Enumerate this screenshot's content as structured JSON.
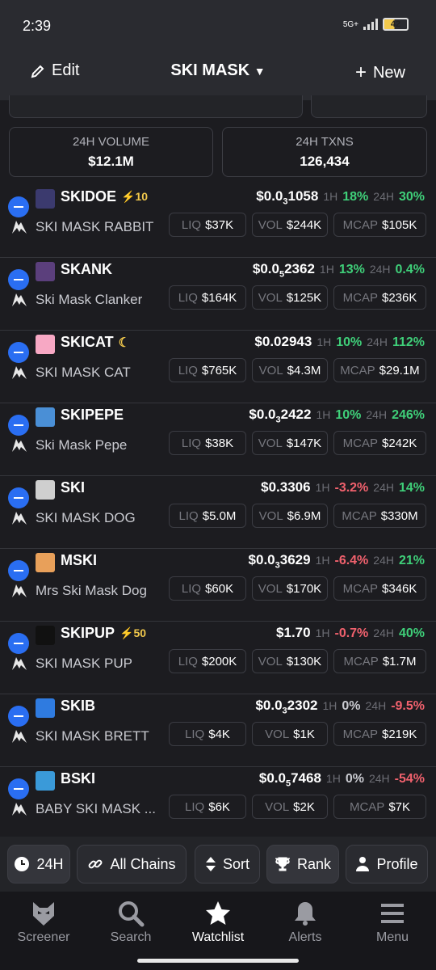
{
  "status": {
    "time": "2:39",
    "net": "5G+",
    "battery": "42"
  },
  "header": {
    "edit": "Edit",
    "title": "SKI MASK",
    "new": "New"
  },
  "stats": [
    {
      "label": "24H VOLUME",
      "value": "$12.1M"
    },
    {
      "label": "24H TXNS",
      "value": "126,434"
    }
  ],
  "labels": {
    "h1": "1H",
    "h24": "24H",
    "liq": "LIQ",
    "vol": "VOL",
    "mcap": "MCAP"
  },
  "tokens": [
    {
      "symbol": "SKIDOE",
      "boost": "10",
      "name": "SKI MASK RABBIT",
      "price_main": "$0.0",
      "price_sub": "3",
      "price_tail": "1058",
      "h1": "18%",
      "h1c": "g",
      "h24": "30%",
      "h24c": "g",
      "liq": "$37K",
      "vol": "$244K",
      "mcap": "$105K",
      "logo": "#3b3a6e"
    },
    {
      "symbol": "SKANK",
      "boost": "",
      "name": "Ski Mask Clanker",
      "price_main": "$0.0",
      "price_sub": "5",
      "price_tail": "2362",
      "h1": "13%",
      "h1c": "g",
      "h24": "0.4%",
      "h24c": "g",
      "liq": "$164K",
      "vol": "$125K",
      "mcap": "$236K",
      "logo": "#5b3f7c"
    },
    {
      "symbol": "SKICAT",
      "boost": "",
      "moon": true,
      "name": "SKI MASK CAT",
      "price_main": "$0.02943",
      "price_sub": "",
      "price_tail": "",
      "h1": "10%",
      "h1c": "g",
      "h24": "112%",
      "h24c": "g",
      "liq": "$765K",
      "vol": "$4.3M",
      "mcap": "$29.1M",
      "logo": "#f7a8c4"
    },
    {
      "symbol": "SKIPEPE",
      "boost": "",
      "name": "Ski Mask Pepe",
      "price_main": "$0.0",
      "price_sub": "3",
      "price_tail": "2422",
      "h1": "10%",
      "h1c": "g",
      "h24": "246%",
      "h24c": "g",
      "liq": "$38K",
      "vol": "$147K",
      "mcap": "$242K",
      "logo": "#4a8fd6"
    },
    {
      "symbol": "SKI",
      "boost": "",
      "name": "SKI MASK DOG",
      "price_main": "$0.3306",
      "price_sub": "",
      "price_tail": "",
      "h1": "-3.2%",
      "h1c": "r",
      "h24": "14%",
      "h24c": "g",
      "liq": "$5.0M",
      "vol": "$6.9M",
      "mcap": "$330M",
      "logo": "#cfcfcf"
    },
    {
      "symbol": "MSKI",
      "boost": "",
      "name": "Mrs Ski Mask Dog",
      "price_main": "$0.0",
      "price_sub": "3",
      "price_tail": "3629",
      "h1": "-6.4%",
      "h1c": "r",
      "h24": "21%",
      "h24c": "g",
      "liq": "$60K",
      "vol": "$170K",
      "mcap": "$346K",
      "logo": "#e8a05a"
    },
    {
      "symbol": "SKIPUP",
      "boost": "50",
      "name": "SKI MASK PUP",
      "price_main": "$1.70",
      "price_sub": "",
      "price_tail": "",
      "h1": "-0.7%",
      "h1c": "r",
      "h24": "40%",
      "h24c": "g",
      "liq": "$200K",
      "vol": "$130K",
      "mcap": "$1.7M",
      "logo": "#111111"
    },
    {
      "symbol": "SKIB",
      "boost": "",
      "name": "SKI MASK BRETT",
      "price_main": "$0.0",
      "price_sub": "3",
      "price_tail": "2302",
      "h1": "0%",
      "h1c": "w",
      "h24": "-9.5%",
      "h24c": "r",
      "liq": "$4K",
      "vol": "$1K",
      "mcap": "$219K",
      "logo": "#2f7be0"
    },
    {
      "symbol": "BSKI",
      "boost": "",
      "name": "BABY SKI MASK ...",
      "price_main": "$0.0",
      "price_sub": "5",
      "price_tail": "7468",
      "h1": "0%",
      "h1c": "w",
      "h24": "-54%",
      "h24c": "r",
      "liq": "$6K",
      "vol": "$2K",
      "mcap": "$7K",
      "logo": "#3a9ad9"
    }
  ],
  "filters": [
    "24H",
    "All Chains",
    "Sort",
    "Rank",
    "Profile"
  ],
  "tabs": [
    "Screener",
    "Search",
    "Watchlist",
    "Alerts",
    "Menu"
  ]
}
